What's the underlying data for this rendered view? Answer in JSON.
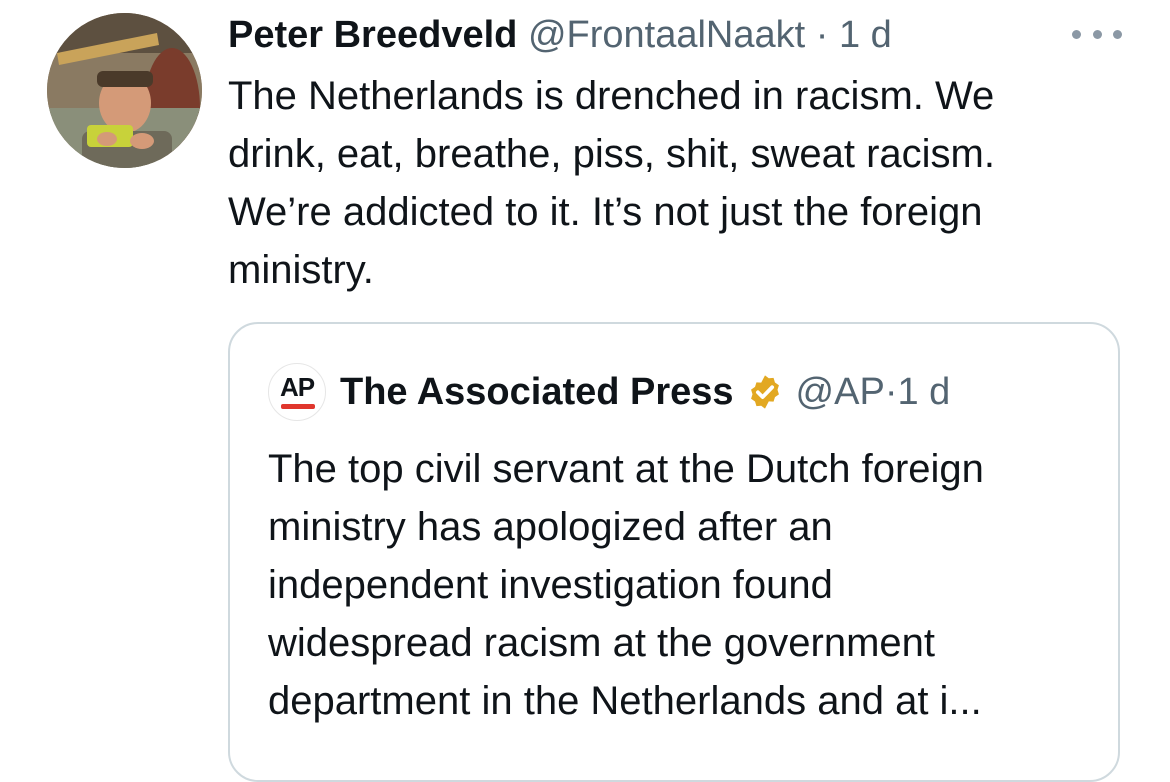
{
  "tweet": {
    "author": {
      "display_name": "Peter Breedveld",
      "handle": "@FrontaalNaakt",
      "separator": "·",
      "time": "1 d",
      "avatar_icon": "user-avatar-photo"
    },
    "more_icon": "more-horizontal-icon",
    "text_lines": [
      "The Netherlands is drenched in racism. We",
      "drink, eat, breathe, piss, shit, sweat racism.",
      "We’re addicted to it. It’s not just the foreign",
      "ministry."
    ],
    "quoted": {
      "logo_text": "AP",
      "logo_icon": "ap-logo",
      "display_name": "The Associated Press",
      "verified_icon": "verified-badge-icon",
      "verified_color": "#e2a822",
      "handle": "@AP",
      "separator": "·",
      "time": "1 d",
      "text_lines": [
        "The top civil servant at the Dutch foreign",
        "ministry has apologized after an",
        "independent investigation found",
        "widespread racism at the government",
        "department in the Netherlands and at i..."
      ]
    }
  },
  "colors": {
    "primary_text": "#0f1419",
    "secondary_text": "#536471",
    "border": "#cfd9de",
    "ap_red": "#e0362d"
  }
}
